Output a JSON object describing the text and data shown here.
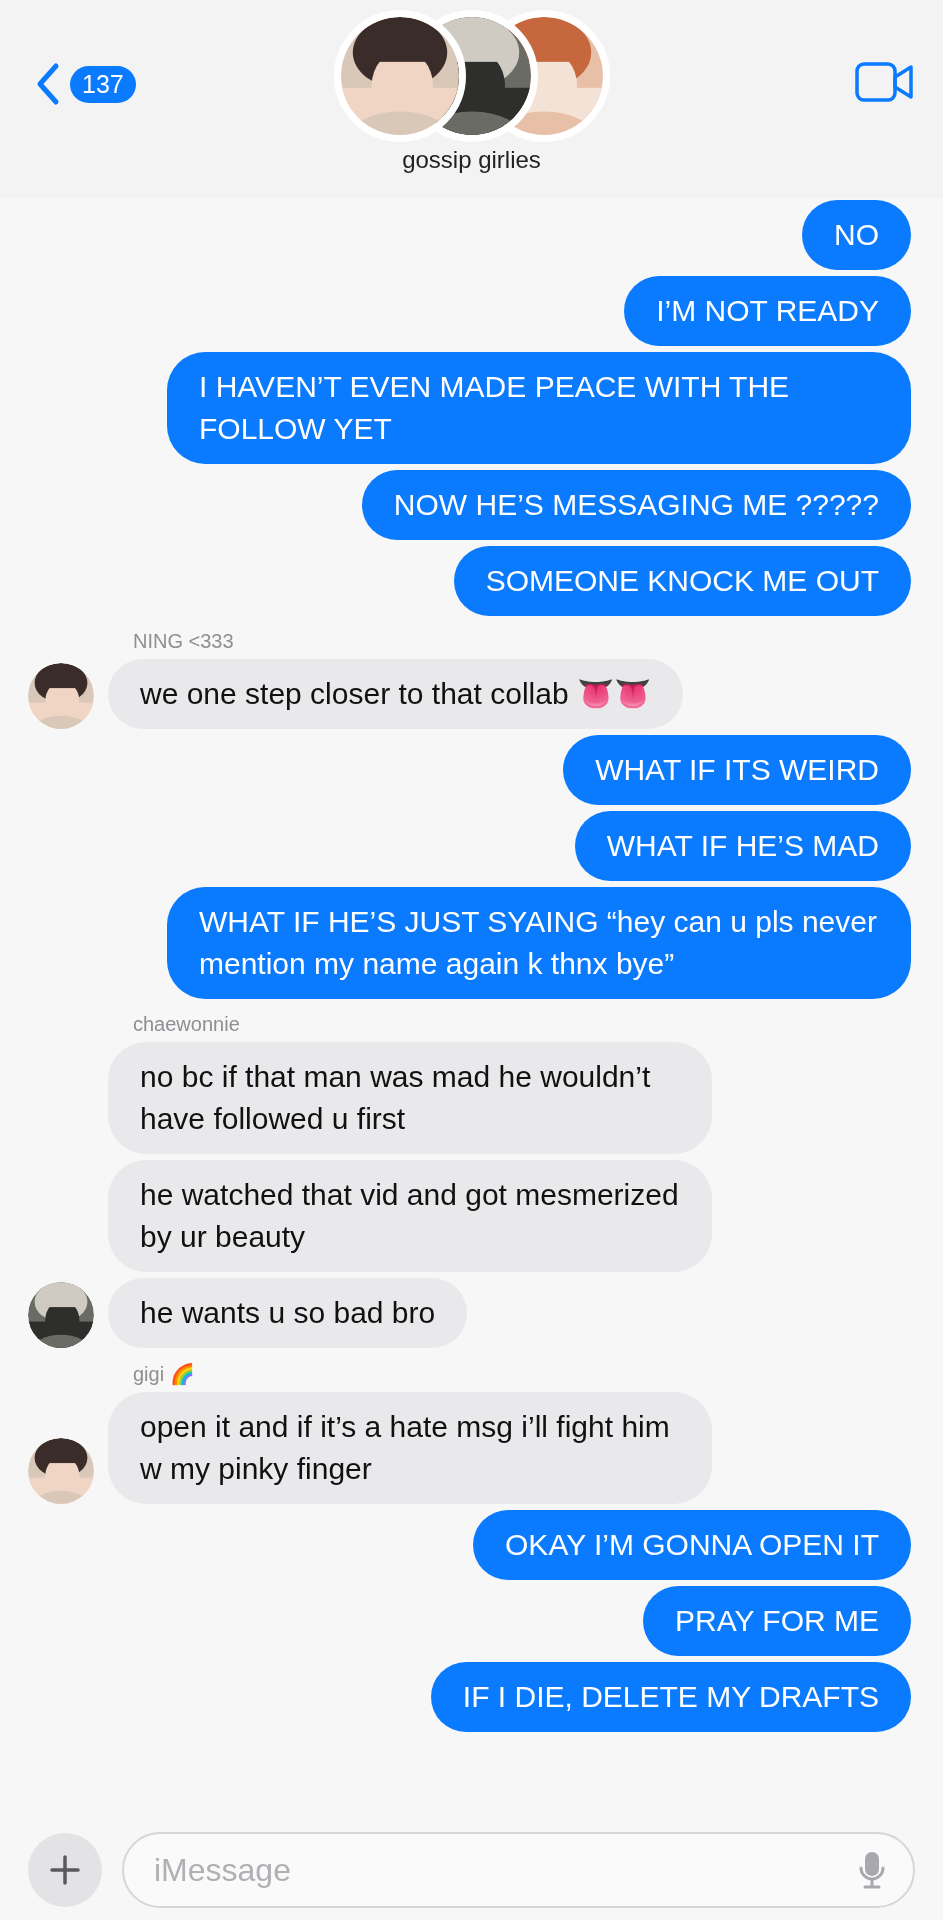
{
  "header": {
    "back_count": "137",
    "group_name": "gossip girlies"
  },
  "messages": [
    {
      "kind": "outgoing",
      "text": "NO"
    },
    {
      "kind": "outgoing",
      "text": "I’M NOT READY"
    },
    {
      "kind": "outgoing",
      "text": "I HAVEN’T EVEN MADE PEACE WITH THE FOLLOW YET"
    },
    {
      "kind": "outgoing",
      "text": "NOW HE’S MESSAGING ME ?????"
    },
    {
      "kind": "outgoing",
      "text": "SOMEONE KNOCK ME OUT"
    },
    {
      "kind": "sender",
      "text": "NING <333"
    },
    {
      "kind": "incoming",
      "text": "we one step closer to that collab 👅👅",
      "avatar": true
    },
    {
      "kind": "outgoing",
      "text": "WHAT IF ITS WEIRD"
    },
    {
      "kind": "outgoing",
      "text": "WHAT IF HE’S MAD"
    },
    {
      "kind": "outgoing",
      "text": "WHAT IF HE’S JUST SYAING “hey can u pls never mention my name again k thnx bye”"
    },
    {
      "kind": "sender",
      "text": "chaewonnie"
    },
    {
      "kind": "incoming",
      "text": "no bc if that man was mad he wouldn’t have followed u first",
      "avatar": false
    },
    {
      "kind": "incoming",
      "text": "he watched that vid and got mesmerized by ur beauty",
      "avatar": false
    },
    {
      "kind": "incoming",
      "text": "he wants u so bad bro",
      "avatar": true
    },
    {
      "kind": "sender",
      "text": "gigi 🌈"
    },
    {
      "kind": "incoming",
      "text": "open it and if it’s a hate msg i’ll fight him w my pinky finger",
      "avatar": true
    },
    {
      "kind": "outgoing",
      "text": "OKAY I’M GONNA OPEN IT"
    },
    {
      "kind": "outgoing",
      "text": "PRAY FOR ME"
    },
    {
      "kind": "outgoing",
      "text": "IF I DIE, DELETE MY DRAFTS"
    }
  ],
  "composer": {
    "placeholder": "iMessage"
  }
}
